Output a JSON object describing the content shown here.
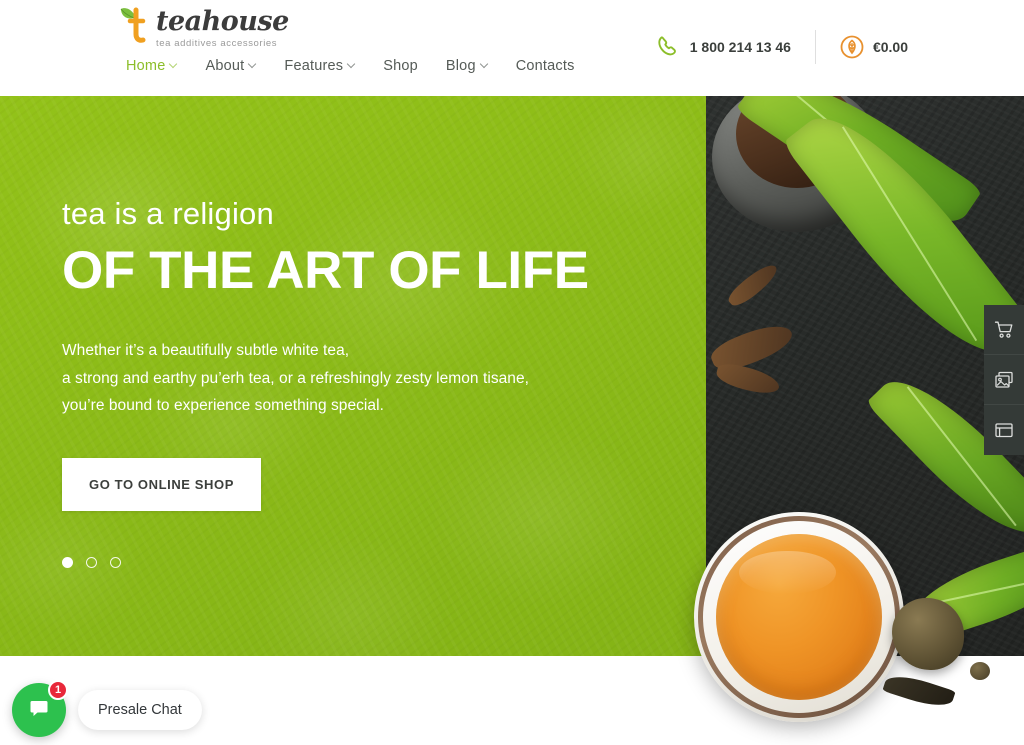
{
  "header": {
    "logo": {
      "word": "teahouse",
      "tagline": "tea additives accessories",
      "mark_icon": "leaf-t-logo-icon"
    },
    "nav": [
      {
        "label": "Home",
        "active": true,
        "has_dropdown": true
      },
      {
        "label": "About",
        "active": false,
        "has_dropdown": true
      },
      {
        "label": "Features",
        "active": false,
        "has_dropdown": true
      },
      {
        "label": "Shop",
        "active": false,
        "has_dropdown": false
      },
      {
        "label": "Blog",
        "active": false,
        "has_dropdown": true
      },
      {
        "label": "Contacts",
        "active": false,
        "has_dropdown": false
      }
    ],
    "phone": {
      "icon": "phone-icon",
      "number": "1 800 214 13 46"
    },
    "cart": {
      "icon": "cart-leaf-icon",
      "total": "€0.00"
    }
  },
  "hero": {
    "kicker": "tea is a religion",
    "title": "OF THE ART OF LIFE",
    "description": [
      "Whether it’s a beautifully subtle white tea,",
      "a strong and earthy pu’erh tea, or a refreshingly zesty lemon tisane,",
      "you’re bound to experience something special."
    ],
    "cta_label": "GO TO ONLINE SHOP",
    "slider": {
      "total": 3,
      "active_index": 0
    }
  },
  "side_toolbar": [
    {
      "icon": "shopping-cart-icon"
    },
    {
      "icon": "image-gallery-icon"
    },
    {
      "icon": "browser-window-icon"
    }
  ],
  "chat": {
    "label": "Presale Chat",
    "badge_count": "1",
    "icon": "chat-bubble-icon"
  },
  "colors": {
    "brand_green": "#8cbe2a",
    "hero_green": "#8cbb18",
    "accent_orange": "#e8912f",
    "chat_green": "#2dc14e",
    "badge_red": "#e8283a",
    "toolbar_dark": "#343a37"
  }
}
